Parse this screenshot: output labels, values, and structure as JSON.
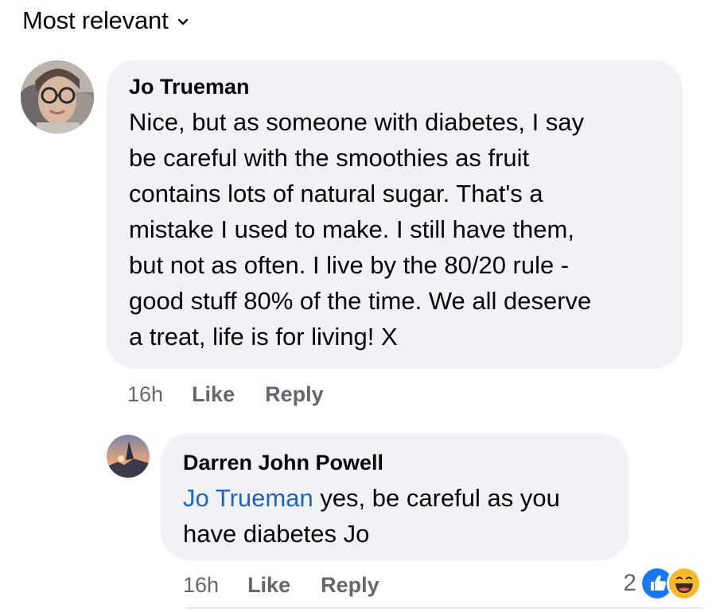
{
  "sort": {
    "label": "Most relevant"
  },
  "comments": [
    {
      "author": "Jo Trueman",
      "text": "Nice, but as someone with diabetes, I say be careful with the smoothies as fruit contains lots of natural sugar. That's a mistake I used to make. I still have them, but not as often. I live by the 80/20 rule - good stuff 80% of the time. We all deserve a treat, life is for living! X",
      "lines": [
        "Nice, but as someone with diabetes, I say",
        "be careful with the smoothies as fruit",
        "contains lots of natural sugar. That's a",
        "mistake I used to make. I still have them,",
        "but not as often. I live by the 80/20 rule -",
        "good stuff 80% of the time. We all deserve",
        "a treat, life is for living! X"
      ],
      "time": "16h",
      "like_label": "Like",
      "reply_label": "Reply"
    }
  ],
  "reply": {
    "author": "Darren John Powell",
    "mention": "Jo Trueman",
    "text_line1": " yes, be careful as you",
    "text_line2": "have diabetes Jo",
    "time": "16h",
    "like_label": "Like",
    "reply_label": "Reply",
    "reaction_count": "2",
    "reactions": [
      "like-icon",
      "haha-icon"
    ]
  },
  "colors": {
    "bubble": "#f0f2f5",
    "secondary_text": "#65676b",
    "mention": "#1c64c7",
    "like_blue": "#1877f2",
    "haha_yellow": "#f7b928"
  }
}
